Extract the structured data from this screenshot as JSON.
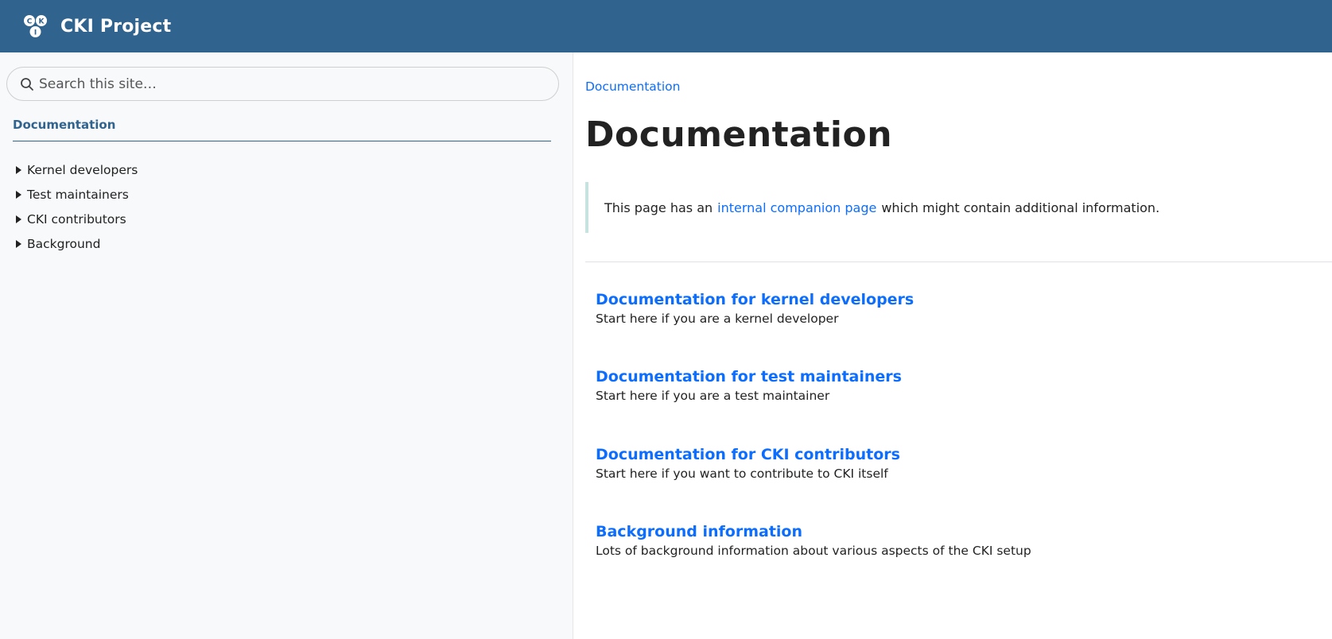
{
  "header": {
    "brand": "CKI Project",
    "logo_icon": "cki-logo-icon",
    "background_color": "#30638e"
  },
  "sidebar": {
    "search_placeholder": "Search this site…",
    "search_icon": "search-icon",
    "title": "Documentation",
    "items": [
      {
        "label": "Kernel developers"
      },
      {
        "label": "Test maintainers"
      },
      {
        "label": "CKI contributors"
      },
      {
        "label": "Background"
      }
    ]
  },
  "main": {
    "breadcrumb": "Documentation",
    "title": "Documentation",
    "note": {
      "before": "This page has an",
      "link": "internal companion page",
      "after": "which might contain additional information."
    },
    "sections": [
      {
        "title": "Documentation for kernel developers",
        "description": "Start here if you are a kernel developer"
      },
      {
        "title": "Documentation for test maintainers",
        "description": "Start here if you are a test maintainer"
      },
      {
        "title": "Documentation for CKI contributors",
        "description": "Start here if you want to contribute to CKI itself"
      },
      {
        "title": "Background information",
        "description": "Lots of background information about various aspects of the CKI setup"
      }
    ]
  },
  "colors": {
    "link": "#0d6efd",
    "sidebar_accent": "#30638e",
    "note_border": "#c7e3e0"
  }
}
